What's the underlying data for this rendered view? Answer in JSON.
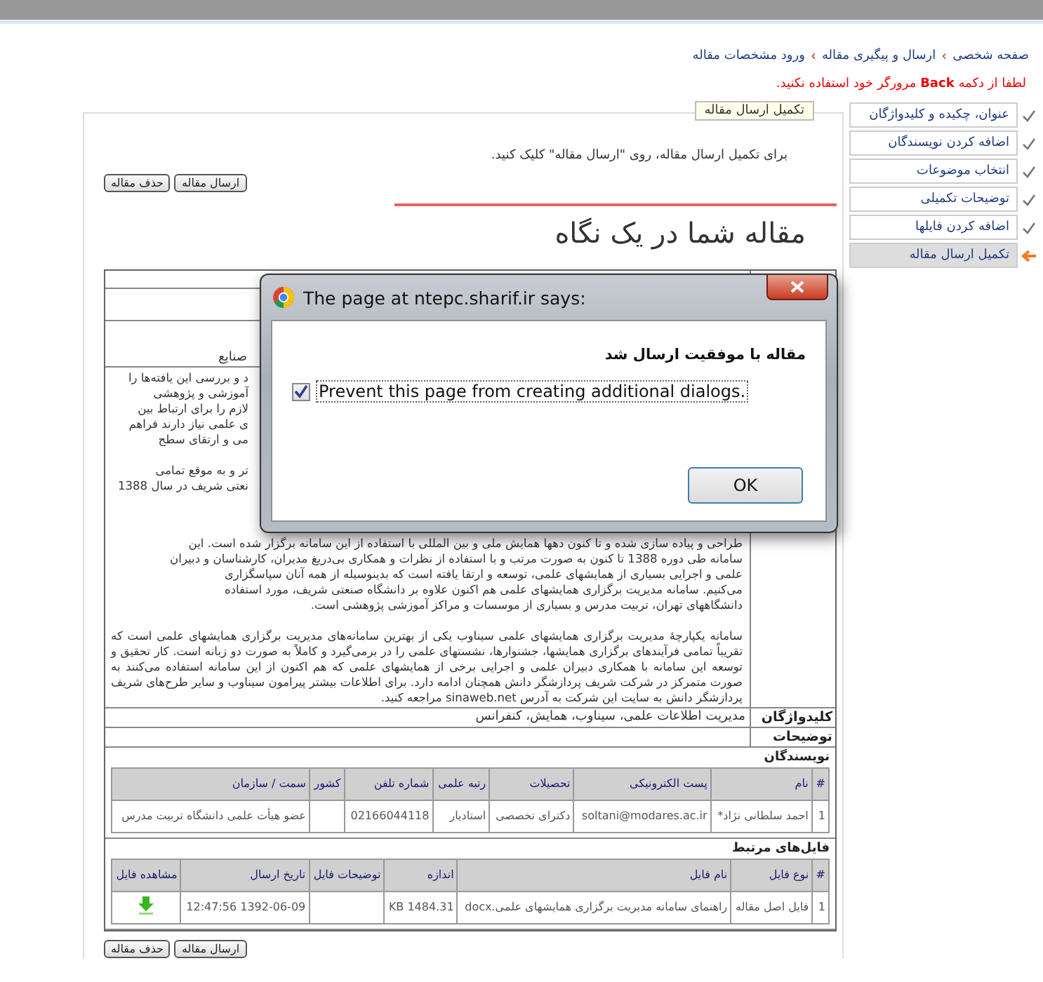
{
  "breadcrumb": {
    "separator": "›",
    "items": [
      "صفحه شخصی",
      "ارسال و پیگیری مقاله",
      "ورود مشخصات مقاله"
    ]
  },
  "warning": "لطفا از دکمه **Back** مرورگر خود استفاده نکنید.",
  "steps": [
    {
      "label": "عنوان، چکیده و کلیدواژگان",
      "done": true,
      "selected": false
    },
    {
      "label": "اضافه کردن نویسندگان",
      "done": true,
      "selected": false
    },
    {
      "label": "انتخاب موضوعات",
      "done": true,
      "selected": false
    },
    {
      "label": "توضیحات تکمیلی",
      "done": true,
      "selected": false
    },
    {
      "label": "اضافه کردن فایلها",
      "done": true,
      "selected": false
    },
    {
      "label": "تکمیل ارسال مقاله",
      "done": false,
      "selected": true
    }
  ],
  "panel": {
    "tab": "تکمیل ارسال مقاله",
    "instruction": "برای تکمیل ارسال مقاله، روی \"ارسال مقاله\" کلیک کنید.",
    "buttons": [
      "ارسال مقاله",
      "حذف مقاله"
    ],
    "heading": "مقاله شما در یک نگاه"
  },
  "details": {
    "covered_fragment": "صنایع",
    "abstract_fragments": [
      [
        "د و بررسی این یافته‌ها را",
        "آموزشی و پژوهشی",
        "لازم را برای ارتباط بین",
        "ی علمی نیاز دارند فراهم",
        "می و ارتقای سطح"
      ],
      [
        "تر و به موقع تمامی",
        "نعتی شریف در سال 1388"
      ]
    ],
    "abstract_lines": [
      "طراحی و پیاده سازی شده و تا کنون دهها همایش ملی و بین المللی با استفاده از این سامانه برگزار شده است. این",
      "سامانه طی دوره 1388 تا کنون به صورت مرتب و با استفاده از نظرات و همکاری بی‌دریغ مدیران، کارشناسان و دبیران",
      "علمی و اجرایی بسیاری از همایشهای علمی، توسعه و ارتقا یافته است که بدینوسیله از همه آنان سپاسگزاری",
      "می‌کنیم. سامانه مدیریت برگزاری همایشهای علمی هم اکنون علاوه بر دانشگاه صنعتی شریف، مورد استفاده",
      "دانشگاههای تهران، تربیت مدرس و بسیاری از موسسات و مراکز آموزشی پژوهشی است."
    ],
    "abstract_paragraph": "سامانه یکپارچۀ مدیریت برگزاری همایشهای علمی سیناوب یکی از بهترین سامانه‌های مدیریت برگزاری همایشهای علمی است که تقریباً تمامی فرآیندهای برگزاری همایشها، جشنوارها، نشستهای علمی را در برمی‌گیرد و کاملاً به صورت دو زبانه است. کار تحقیق و توسعه این سامانه با همکاری دبیران علمی و اجرایی برخی از همایشهای علمی که هم اکنون از این سامانه استفاده می‌کنند به صورت متمرکز در شرکت شریف پردازشگر دانش همچنان ادامه دارد. برای اطلاعات بیشتر پیرامون سیناوب و سایر طرح‌های شریف پردازشگر دانش به سایت این شرکت به آدرس sinaweb.net مراجعه کنید.",
    "keywords_label": "کلیدواژگان",
    "keywords": "مدیریت اطلاعات علمی، سیناوب، همایش، کنفرانس",
    "description_label": "توضیحات"
  },
  "authors": {
    "title": "نویسندگان",
    "columns": [
      {
        "label": "#"
      },
      {
        "label": "نام"
      },
      {
        "label": "پست الکترونیکی"
      },
      {
        "label": "تحصیلات"
      },
      {
        "label": "رتبه علمی"
      },
      {
        "label": "شماره تلفن"
      },
      {
        "label": "کشور"
      },
      {
        "label": "سمت / سازمان"
      }
    ],
    "rows": [
      [
        "1",
        "احمد سلطانی نژاد*",
        "soltani@modares.ac.ir",
        "دکترای تخصصی",
        "استادیار",
        "02166044118",
        null,
        "عضو هیأت علمی دانشگاه تربیت مدرس"
      ]
    ]
  },
  "files": {
    "title": "فایل‌های مرتبط",
    "columns": [
      {
        "label": "#",
        "kind": "text"
      },
      {
        "label": "نوع فایل",
        "kind": "text"
      },
      {
        "label": "نام فایل",
        "kind": "text"
      },
      {
        "label": "اندازه",
        "kind": "text"
      },
      {
        "label": "توضیحات فایل",
        "kind": "text"
      },
      {
        "label": "تاریخ ارسال",
        "kind": "text"
      },
      {
        "label": "مشاهده فایل",
        "kind": "download"
      }
    ],
    "rows": [
      [
        "1",
        "فایل اصل مقاله",
        "راهنمای سامانه مدیریت برگزاری همایشهای علمی.docx",
        "1484.31 KB",
        null,
        "1392-06-09 12:47:56",
        null
      ]
    ]
  },
  "bottom_buttons": [
    "ارسال مقاله",
    "حذف مقاله"
  ],
  "dialog": {
    "title": "The page at ntepc.sharif.ir says:",
    "message": "مقاله با موفقیت ارسال شد",
    "checkbox": {
      "label": "Prevent this page from creating additional dialogs.",
      "checked": true
    },
    "ok": "OK"
  }
}
